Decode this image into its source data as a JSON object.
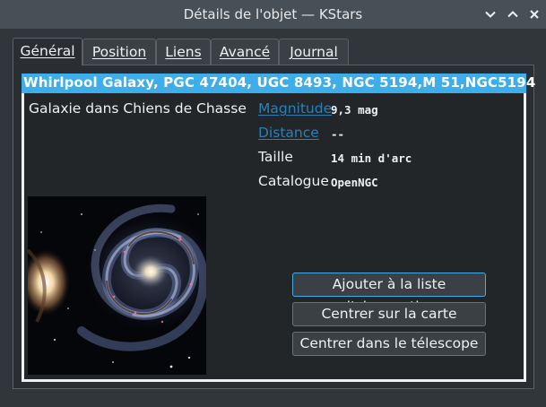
{
  "window": {
    "title": "Détails de l'objet — KStars"
  },
  "tabs": [
    {
      "label": "Général",
      "active": true
    },
    {
      "label": "Position",
      "active": false
    },
    {
      "label": "Liens",
      "active": false
    },
    {
      "label": "Avancé",
      "active": false
    },
    {
      "label": "Journal",
      "active": false
    }
  ],
  "object": {
    "names": "Whirlpool Galaxy, PGC 47404, UGC 8493, NGC 5194,M 51,NGC5194",
    "type_text": "Galaxie dans Chiens de Chasse"
  },
  "properties": [
    {
      "label": "Magnitude",
      "value": "9,3 mag",
      "link": true
    },
    {
      "label": "Distance",
      "value": "--",
      "link": true
    },
    {
      "label": "Taille",
      "value": "14 min d'arc",
      "link": false
    },
    {
      "label": "Catalogue",
      "value": "OpenNGC",
      "link": false
    }
  ],
  "buttons": {
    "add_observation": "Ajouter à la liste d'observation",
    "center_map": "Centrer sur la carte",
    "center_telescope": "Centrer dans le télescope"
  },
  "colors": {
    "accent": "#3daee9",
    "link": "#2980b9",
    "window_bg": "#31363b",
    "titlebar_bg": "#475057"
  },
  "icons": {
    "minimize": "chevron-down-icon",
    "maximize": "chevron-up-icon",
    "close": "close-icon"
  }
}
